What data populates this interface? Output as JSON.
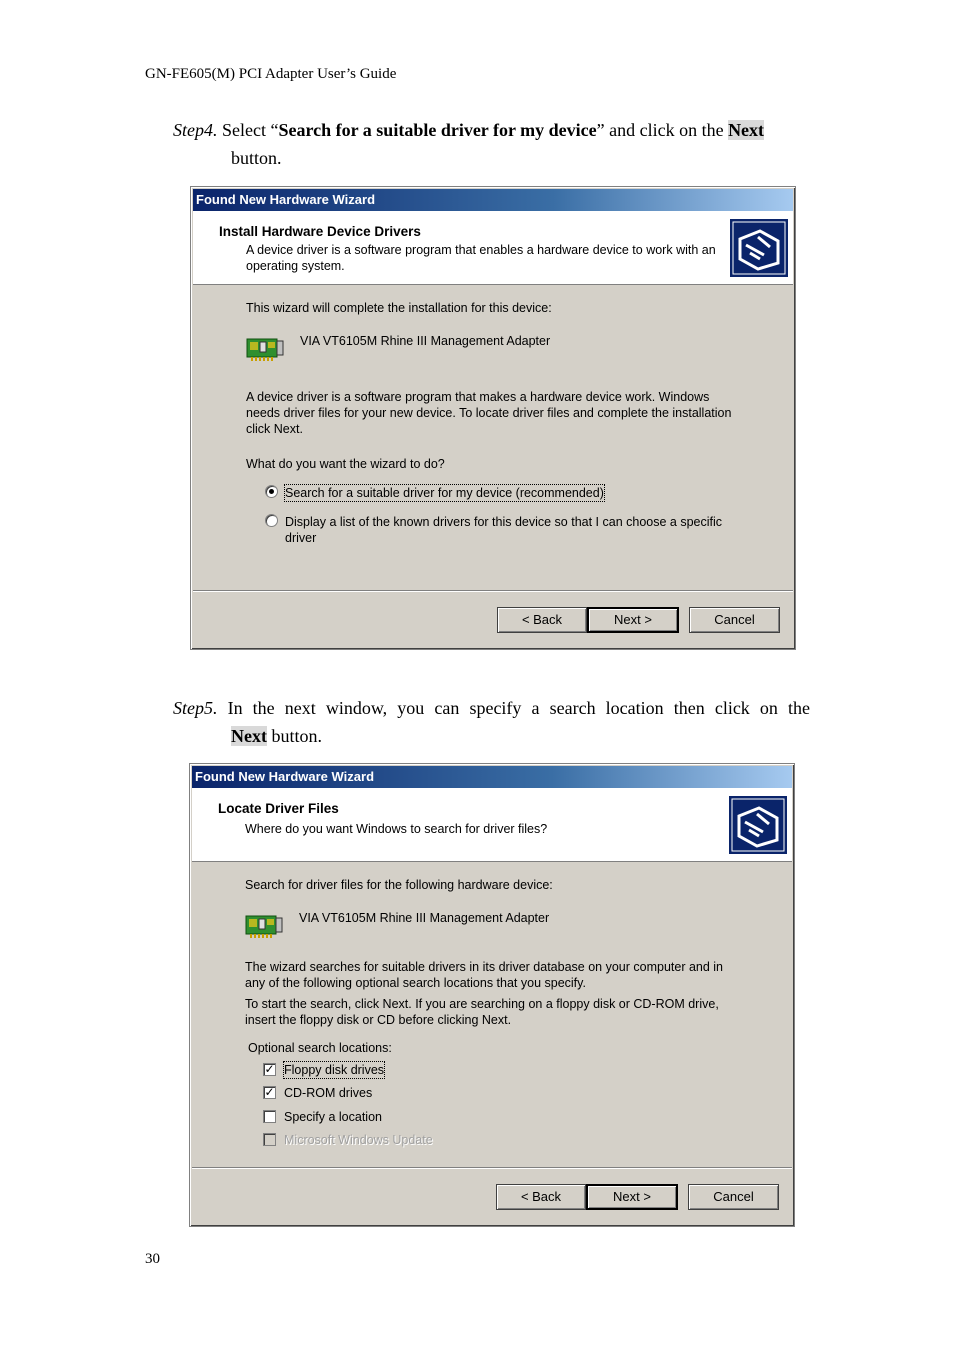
{
  "page": {
    "header": "GN-FE605(M) PCI Adapter User’s Guide",
    "page_number": "30"
  },
  "step4": {
    "label": "Step4.",
    "pre": " Select “",
    "option_bold": "Search for a suitable driver for my device",
    "mid": "” and click on the ",
    "next_word": "Next",
    "line2": "button."
  },
  "step5": {
    "label": "Step5.",
    "line1_rest": " In the next window, you can specify a search location then click on the",
    "next_word": "Next",
    "line2_rest": " button."
  },
  "wizard1": {
    "title": "Found New Hardware Wizard",
    "heading": "Install Hardware Device Drivers",
    "subheading": "A device driver is a software program that enables a hardware device to work with an operating system.",
    "intro": "This wizard will complete the installation for this device:",
    "device_name": "VIA VT6105M Rhine III Management Adapter",
    "description": "A device driver is a software program that makes a hardware device work. Windows needs driver files for your new device. To locate driver files and complete the installation click Next.",
    "question": "What do you want the wizard to do?",
    "radio1_label": "Search for a suitable driver for my device (recommended)",
    "radio2_label": "Display a list of the known drivers for this device so that I can choose a specific driver",
    "back_label": "< Back",
    "next_label": "Next >",
    "cancel_label": "Cancel",
    "icon_wizard": "wizard-hardware-icon",
    "icon_device": "network-card-icon"
  },
  "wizard2": {
    "title": "Found New Hardware Wizard",
    "heading": "Locate Driver Files",
    "subheading": "Where do you want Windows to search for driver files?",
    "intro": "Search for driver files for the following hardware device:",
    "device_name": "VIA VT6105M Rhine III Management Adapter",
    "para1": "The wizard searches for suitable drivers in its driver database on your computer and in any of the following optional search locations that you specify.",
    "para2": "To start the search, click Next. If you are searching on a floppy disk or CD-ROM drive, insert the floppy disk or CD before clicking Next.",
    "optional_label": "Optional search locations:",
    "options": [
      {
        "label": "Floppy disk drives",
        "checked": true,
        "enabled": true
      },
      {
        "label": "CD-ROM drives",
        "checked": true,
        "enabled": true
      },
      {
        "label": "Specify a location",
        "checked": false,
        "enabled": true
      },
      {
        "label": "Microsoft Windows Update",
        "checked": false,
        "enabled": false
      }
    ],
    "back_label": "< Back",
    "next_label": "Next >",
    "cancel_label": "Cancel"
  },
  "colors": {
    "titlebar_start": "#0a246a",
    "titlebar_end": "#a6caf0",
    "dialog_face": "#d4d0c8",
    "highlight_bg": "#d9d9d9"
  }
}
